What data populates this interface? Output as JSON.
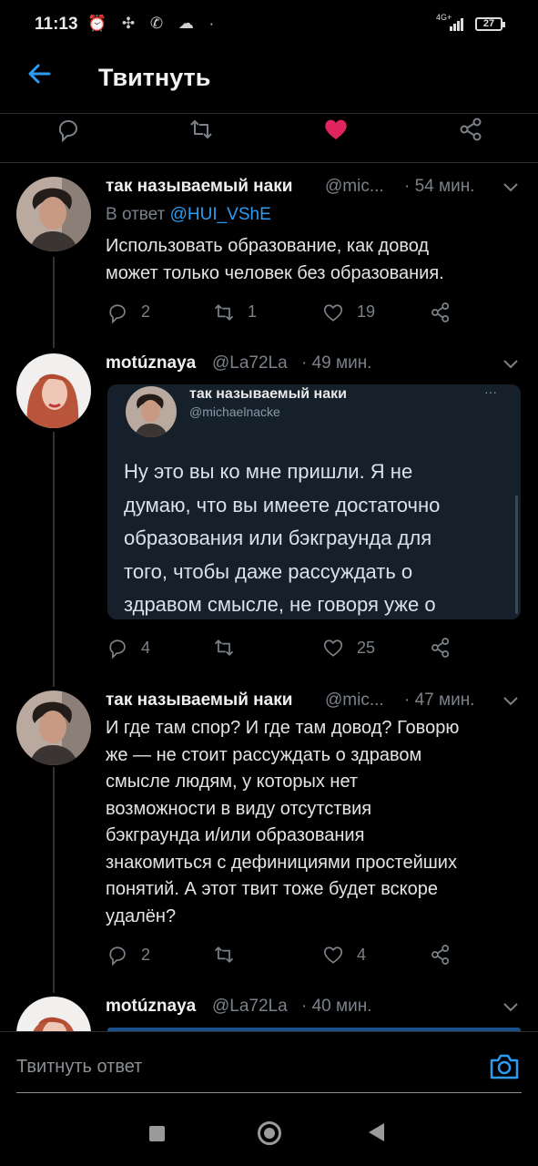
{
  "status_bar": {
    "time": "11:13",
    "notification_icons": "⏰ ✣ ✆ ☁ ·",
    "network": "4G+",
    "battery": "27"
  },
  "header": {
    "title": "Твитнуть"
  },
  "tweets": [
    {
      "name": "так называемый наки",
      "handle": "@mic...",
      "time": "· 54 мин.",
      "reply_prefix": "В ответ",
      "reply_to": "@HUI_VShE",
      "lines": [
        "Использовать образование, как довод",
        "может только человек без образования."
      ],
      "replies": "2",
      "retweets": "1",
      "likes": "19"
    },
    {
      "name": "motúznaya",
      "handle": "@La72La",
      "time": "· 49 мин.",
      "quote": {
        "name": "так называемый наки",
        "handle": "@michaelnacke",
        "more": "···",
        "lines": [
          "Ну это вы ко мне пришли. Я не",
          "думаю, что вы имеете достаточно",
          "образования или бэкграунда для",
          "того, чтобы даже рассуждать о",
          "здравом смысле, не говоря уже о"
        ]
      },
      "replies": "4",
      "retweets": "",
      "likes": "25"
    },
    {
      "name": "так называемый наки",
      "handle": "@mic...",
      "time": "· 47 мин.",
      "lines": [
        "И где там спор? И где там довод? Говорю",
        "же — не стоит рассуждать о здравом",
        "смысле людям, у которых нет",
        "возможности в виду отсутствия",
        "бэкграунда и/или образования",
        "знакомиться с дефинициями простейших",
        "понятий. А этот твит тоже будет вскоре",
        "удалён?"
      ],
      "replies": "2",
      "retweets": "",
      "likes": "4"
    },
    {
      "name": "motúznaya",
      "handle": "@La72La",
      "time": "· 40 мин."
    }
  ],
  "reply_bar": {
    "placeholder": "Твитнуть ответ"
  },
  "colors": {
    "accent": "#2d9cf0",
    "like": "#e0245e",
    "muted": "#7b8189"
  }
}
